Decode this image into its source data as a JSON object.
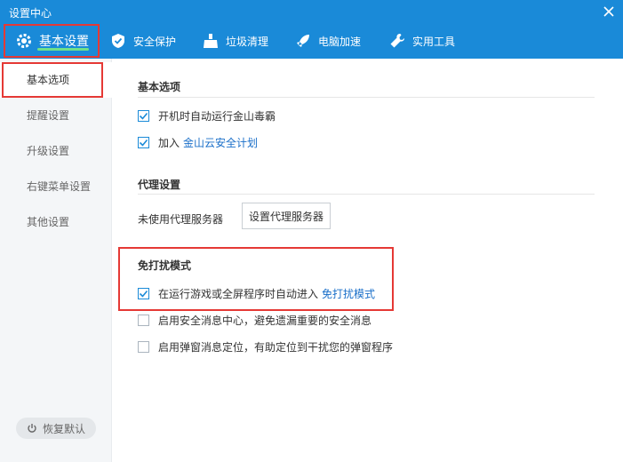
{
  "window": {
    "title": "设置中心"
  },
  "tabs": [
    {
      "label": "基本设置",
      "icon": "gear-icon",
      "active": true
    },
    {
      "label": "安全保护",
      "icon": "shield-icon"
    },
    {
      "label": "垃圾清理",
      "icon": "broom-icon"
    },
    {
      "label": "电脑加速",
      "icon": "rocket-icon"
    },
    {
      "label": "实用工具",
      "icon": "wrench-icon"
    }
  ],
  "sidebar": {
    "items": [
      {
        "label": "基本选项",
        "active": true
      },
      {
        "label": "提醒设置"
      },
      {
        "label": "升级设置"
      },
      {
        "label": "右键菜单设置"
      },
      {
        "label": "其他设置"
      }
    ],
    "restore_label": "恢复默认"
  },
  "sections": {
    "basic": {
      "title": "基本选项",
      "opt_autostart": "开机时自动运行金山毒霸",
      "opt_join_prefix": "加入",
      "opt_join_link": "金山云安全计划"
    },
    "proxy": {
      "title": "代理设置",
      "status": "未使用代理服务器",
      "button": "设置代理服务器"
    },
    "dnd": {
      "title": "免打扰模式",
      "opt_game_prefix": "在运行游戏或全屏程序时自动进入",
      "opt_game_link": "免打扰模式",
      "opt_msgcenter": "启用安全消息中心，避免遗漏重要的安全消息",
      "opt_popup": "启用弹窗消息定位，有助定位到干扰您的弹窗程序"
    }
  },
  "colors": {
    "titlebar": "#1a8ad8",
    "accent": "#1a8ad8",
    "highlight": "#e53935",
    "link": "#1a6fc9"
  }
}
